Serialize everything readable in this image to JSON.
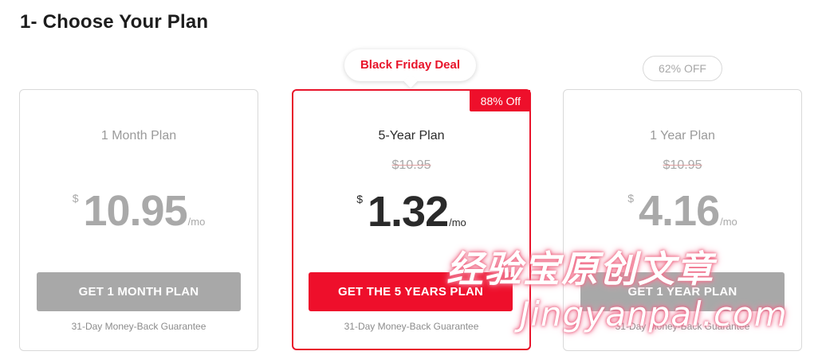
{
  "page": {
    "title": "1- Choose Your Plan"
  },
  "colors": {
    "accent": "#ee0f2b",
    "muted": "#a8a8a8",
    "text": "#2a2a2a"
  },
  "badges": {
    "deal": "Black Friday Deal",
    "discount_pill": "62% OFF",
    "ribbon": "88% Off"
  },
  "plans": [
    {
      "name": "1 Month Plan",
      "old_price": "",
      "currency": "$",
      "amount": "10.95",
      "per": "/mo",
      "cta": "GET 1 MONTH PLAN",
      "guarantee": "31-Day Money-Back Guarantee"
    },
    {
      "name": "5-Year Plan",
      "old_price": "$10.95",
      "currency": "$",
      "amount": "1.32",
      "per": "/mo",
      "cta": "GET THE 5 YEARS PLAN",
      "guarantee": "31-Day Money-Back Guarantee"
    },
    {
      "name": "1 Year Plan",
      "old_price": "$10.95",
      "currency": "$",
      "amount": "4.16",
      "per": "/mo",
      "cta": "GET 1 YEAR PLAN",
      "guarantee": "31-Day Money-Back Guarantee"
    }
  ],
  "watermark": {
    "cn": "经验宝原创文章",
    "en": "Jingyanpal.com"
  }
}
